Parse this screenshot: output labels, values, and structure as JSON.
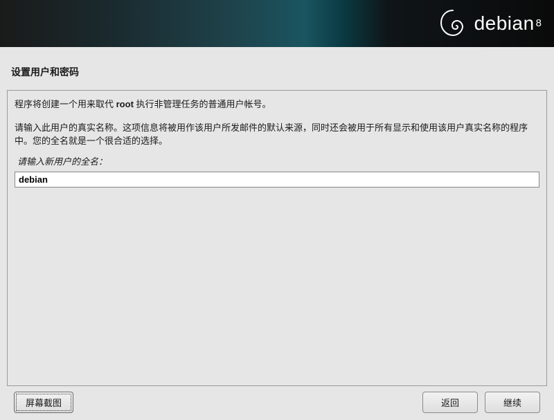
{
  "header": {
    "brand": "debian",
    "version": "8"
  },
  "page": {
    "title": "设置用户和密码"
  },
  "body": {
    "info_prefix": "程序将创建一个用来取代 ",
    "info_root": "root",
    "info_suffix": " 执行非管理任务的普通用户帐号。",
    "info2_a": "请输入此用户的真实名称。这项信息将被用作该用户所发邮",
    "info2_b": "件",
    "info2_c": "的默认来源，同时还会被用于所有显示",
    "info2_d": "和使用",
    "info2_e": "该用户真实",
    "info2_f": "名称",
    "info2_g": "的程序中。",
    "info2_h": "您",
    "info2_i": "的全名就是一个很合适的选择。",
    "field_label": "请输入新用户的全名：",
    "input_value": "debian"
  },
  "buttons": {
    "screenshot": "屏幕截图",
    "back": "返回",
    "continue": "继续"
  }
}
